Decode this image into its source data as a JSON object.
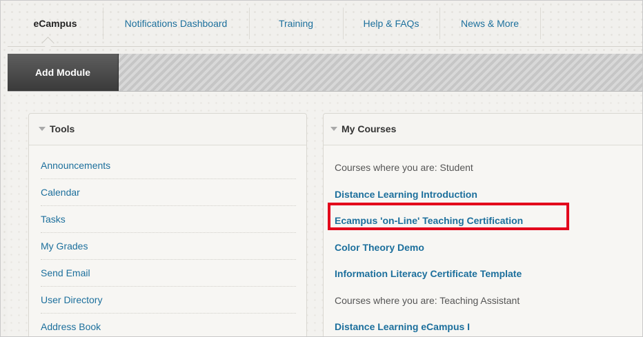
{
  "nav": {
    "tabs": [
      {
        "label": "eCampus",
        "active": true
      },
      {
        "label": "Notifications Dashboard",
        "active": false
      },
      {
        "label": "Training",
        "active": false
      },
      {
        "label": "Help & FAQs",
        "active": false
      },
      {
        "label": "News & More",
        "active": false
      }
    ]
  },
  "toolbar": {
    "add_module_label": "Add Module"
  },
  "tools": {
    "title": "Tools",
    "items": [
      "Announcements",
      "Calendar",
      "Tasks",
      "My Grades",
      "Send Email",
      "User Directory",
      "Address Book"
    ]
  },
  "my_courses": {
    "title": "My Courses",
    "student_label": "Courses where you are: Student",
    "student_courses": [
      "Distance Learning Introduction",
      "Ecampus 'on-Line' Teaching Certification",
      "Color Theory Demo",
      "Information Literacy Certificate Template"
    ],
    "ta_label": "Courses where you are: Teaching Assistant",
    "ta_courses": [
      "Distance Learning eCampus I"
    ]
  },
  "colors": {
    "link": "#1c6f9c",
    "highlight": "#e3001b",
    "toolbar_button": "#4a4a4a"
  }
}
